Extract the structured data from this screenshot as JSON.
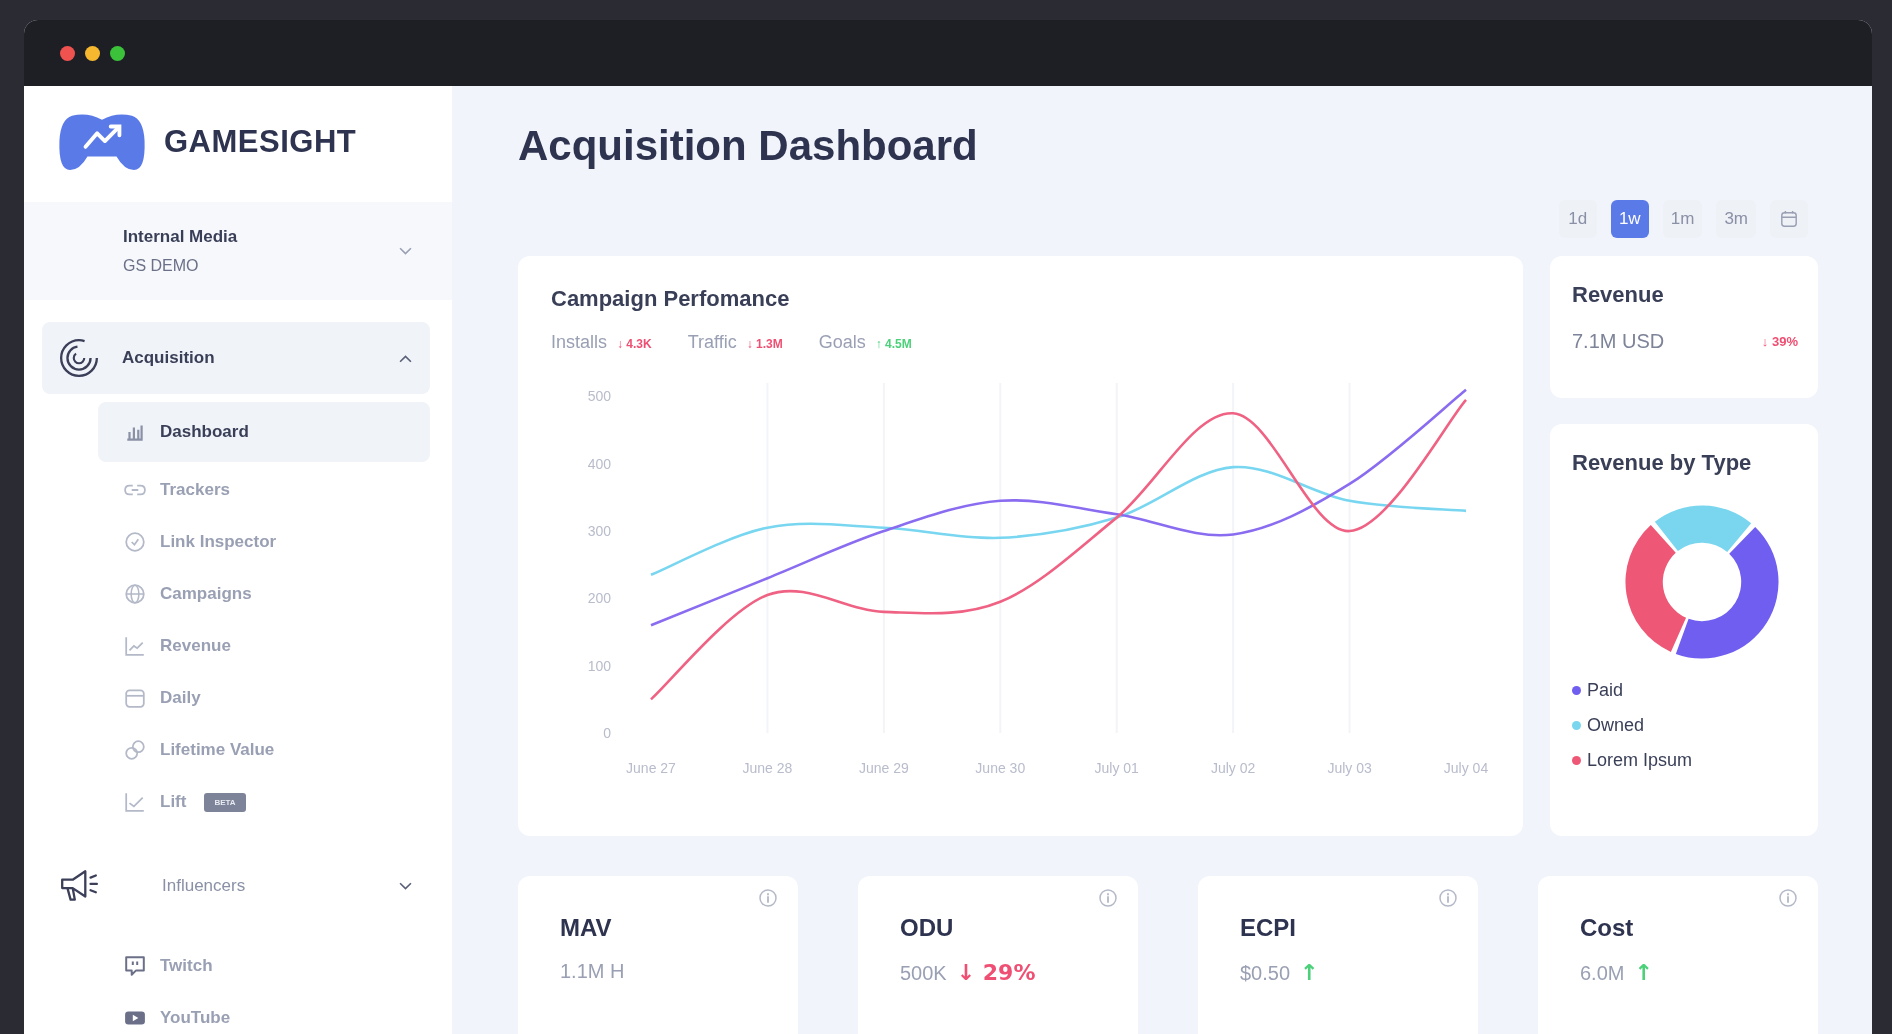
{
  "window": {
    "controls": [
      {
        "color": "#f0524f"
      },
      {
        "color": "#f5b82e"
      },
      {
        "color": "#3cc13b"
      }
    ]
  },
  "sidebar": {
    "brand": "GAMESIGHT",
    "account": {
      "name": "Internal Media",
      "workspace": "GS DEMO",
      "expanded": false
    },
    "groups": [
      {
        "label": "Acquisition",
        "expanded": true,
        "selected": true,
        "children": [
          {
            "label": "Dashboard",
            "selected": true
          },
          {
            "label": "Trackers",
            "selected": false
          },
          {
            "label": "Link Inspector",
            "selected": false
          },
          {
            "label": "Campaigns",
            "selected": false
          },
          {
            "label": "Revenue",
            "selected": false
          },
          {
            "label": "Daily",
            "selected": false
          },
          {
            "label": "Lifetime Value",
            "selected": false
          },
          {
            "label": "Lift",
            "selected": false,
            "badge": "BETA"
          }
        ]
      },
      {
        "label": "Influencers",
        "expanded": false,
        "selected": false,
        "children": [
          {
            "label": "Twitch",
            "selected": false
          },
          {
            "label": "YouTube",
            "selected": false
          }
        ]
      }
    ]
  },
  "page_title": "Acquisition Dashboard",
  "ranges": [
    {
      "label": "1d",
      "selected": false
    },
    {
      "label": "1w",
      "selected": true
    },
    {
      "label": "1m",
      "selected": false
    },
    {
      "label": "3m",
      "selected": false
    }
  ],
  "campaign_card": {
    "title": "Campaign Perfomance",
    "metrics": [
      {
        "label": "Installs",
        "delta": "↓ 4.3K",
        "color": "#ef4f72"
      },
      {
        "label": "Traffic",
        "delta": "↓ 1.3M",
        "color": "#ef4f72"
      },
      {
        "label": "Goals",
        "delta": "↑ 4.5M",
        "color": "#4cd07a"
      }
    ],
    "chart_data": {
      "type": "line",
      "grid": true,
      "categories": [
        "June 27",
        "June 28",
        "June 29",
        "June 30",
        "July 01",
        "July 02",
        "July 03",
        "July 04"
      ],
      "ylim": [
        0,
        520
      ],
      "yticks": [
        0,
        100,
        200,
        300,
        400,
        500
      ],
      "series": [
        {
          "color": "#78d6f0",
          "values": [
            235,
            305,
            305,
            290,
            320,
            395,
            345,
            330
          ]
        },
        {
          "color": "#8a6cf0",
          "values": [
            160,
            230,
            300,
            345,
            325,
            295,
            370,
            510
          ]
        },
        {
          "color": "#ef6283",
          "values": [
            50,
            205,
            180,
            195,
            320,
            475,
            300,
            495
          ]
        }
      ]
    }
  },
  "revenue_card": {
    "title": "Revenue",
    "value": "7.1M USD",
    "delta": "↓ 39%",
    "color": "#ef4f72"
  },
  "revenue_type_card": {
    "title": "Revenue by Type",
    "legend": [
      {
        "label": "Paid",
        "color": "#6f5ef0"
      },
      {
        "label": "Owned",
        "color": "#7ad6ee"
      },
      {
        "label": "Lorem Ipsum",
        "color": "#ee5876"
      }
    ]
  },
  "kpis": [
    {
      "title": "MAV",
      "value": "1.1M H"
    },
    {
      "title": "ODU",
      "value": "500K",
      "delta": "↓ 29%",
      "color": "#ef4f72"
    },
    {
      "title": "ECPI",
      "value": "$0.50",
      "delta": "↑",
      "color": "#4cd07a"
    },
    {
      "title": "Cost",
      "value": "6.0M",
      "delta": "↑",
      "color": "#4cd07a"
    }
  ]
}
